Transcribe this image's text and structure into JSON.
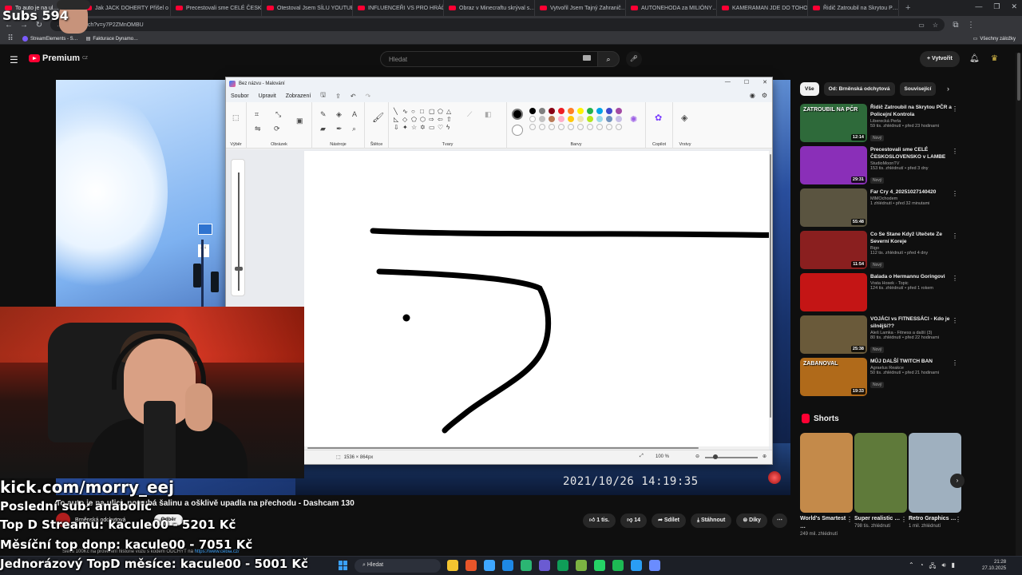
{
  "browser": {
    "tabs": [
      {
        "label": "To auto je na ul…",
        "active": true
      },
      {
        "label": "Jak JACK DOHERTY Přišel o V…"
      },
      {
        "label": "Precestovali sme CELÉ ČESKO…"
      },
      {
        "label": "Otestoval Jsem SÍLU YOUTUB…"
      },
      {
        "label": "INFLUENCEŘI VS PRO HRÁČI…"
      },
      {
        "label": "Obraz v Minecraftu skrýval s…"
      },
      {
        "label": "Vytvořil Jsem Tajný Zahranič…"
      },
      {
        "label": "AUTONEHODA za MILIÓNY…"
      },
      {
        "label": "KAMERAMAN JDE DO TOHO…"
      },
      {
        "label": "Řidič Zatroubil na Skrytou P…"
      }
    ],
    "address": "…e.com/watch?v=y7P2ZMnOMBU",
    "bookmarks": [
      "StreamElements - S…",
      "Fakturace Dynamo…"
    ],
    "all_bookmarks": "Všechny záložky"
  },
  "youtube": {
    "logo": "Premium",
    "logo_sup": "CZ",
    "search_placeholder": "Hledat",
    "create_label": "+ Vytvořit",
    "video_title": "To auto je na ulici, potrubá šalinu a ošklivě upadla na přechodu - Dashcam 130",
    "channel": "Brněnská odchytová",
    "subscribe": "Odběr",
    "actions": {
      "like": "1 tis.",
      "dislike": "14",
      "share": "Sdílet",
      "download": "Stáhnout",
      "thanks": "Díky"
    },
    "description_snippet": "Sleva 100Kč na prověření historie vozu s kódem ODCHYT na",
    "description_link": "https://www.cebia.cz/",
    "dashcam_timestamp": "2021/10/26 14:19:35",
    "chips": [
      "Vše",
      "Od: Brněnská odchytová",
      "Související"
    ],
    "recommendations": [
      {
        "title": "Řidič Zatroubil na Skrytou PČR a Policejní Kontrola",
        "channel": "Liberecká Perla",
        "views": "59 tis. zhlédnutí • před 23 hodinami",
        "badge": "Nový",
        "duration": "12:14",
        "thumb": "#2e6a3a",
        "thumb_text": "ZATROUBIL NA PČR"
      },
      {
        "title": "Precestovali sme CELÉ ČESKOSLOVENSKO v LAMBE",
        "channel": "StudioMoonTV",
        "views": "153 tis. zhlédnutí • před 3 dny",
        "badge": "Nový",
        "duration": "29:31",
        "thumb": "#8a2fb8"
      },
      {
        "title": "Far Cry 4_20251027140420",
        "channel": "MlMOchodem",
        "views": "1 zhlédnutí • před 32 minutami",
        "badge": "",
        "duration": "55:48",
        "thumb": "#5a5440"
      },
      {
        "title": "Co Se Stane Když Utečete Ze Severní Koreje",
        "channel": "Bigo",
        "views": "112 tis. zhlédnutí • před 4 dny",
        "badge": "Nový",
        "duration": "11:54",
        "thumb": "#8a1f1f"
      },
      {
        "title": "Balada o Hermannu Goringovi",
        "channel": "Vrata Hosek - Topic",
        "views": "124 tis. zhlédnutí • před 1 rokem",
        "badge": "",
        "duration": "",
        "thumb": "#c41515"
      },
      {
        "title": "VOJÁCI vs FITNESSÁCI - Kdo je silnější??",
        "channel": "Aleš Lamka - Fitness a další (3)",
        "views": "80 tis. zhlédnutí • před 22 hodinami",
        "badge": "Nový",
        "duration": "25:38",
        "thumb": "#6a5a3a"
      },
      {
        "title": "MŮJ DALŠÍ TWITCH BAN",
        "channel": "Agraelus Reakce",
        "views": "50 tis. zhlédnutí • před 21 hodinami",
        "badge": "Nový",
        "duration": "19:33",
        "thumb": "#b06a1a",
        "thumb_text": "ZABANOVAL"
      }
    ],
    "shorts_title": "Shorts",
    "shorts": [
      {
        "title": "World's Smartest …",
        "views": "249 mil. zhlédnutí",
        "thumb": "#c48a4a"
      },
      {
        "title": "Super realistic …",
        "views": "798 tis. zhlédnutí",
        "thumb": "#5f7a3a"
      },
      {
        "title": "Retro Graphics …",
        "views": "1 mil. zhlédnutí",
        "thumb": "#9fb0bf"
      }
    ]
  },
  "paint": {
    "window_title": "Bez názvu - Malování",
    "menu": [
      "Soubor",
      "Upravit",
      "Zobrazení"
    ],
    "groups": [
      "Výběr",
      "Obrázek",
      "Nástroje",
      "Štětce",
      "Tvary",
      "Barvy",
      "Copilot",
      "Vrstvy"
    ],
    "palette_row1": [
      "#000000",
      "#7f7f7f",
      "#880015",
      "#ed1c24",
      "#ff7f27",
      "#fff200",
      "#22b14c",
      "#00a2e8",
      "#3f48cc",
      "#a349a4"
    ],
    "palette_row2": [
      "#ffffff",
      "#c3c3c3",
      "#b97a57",
      "#ffaec9",
      "#ffc90e",
      "#efe4b0",
      "#b5e61d",
      "#99d9ea",
      "#7092be",
      "#c8bfe7"
    ],
    "canvas_size": "1536 × 864px",
    "zoom": "100 %"
  },
  "stream_overlay": {
    "subs": "Subs 594",
    "kick": "kick.com/morry_eej",
    "last_sub": "Poslední sub: anabolic",
    "top_stream": "Top D Streamu: kacule00 - 5201 Kč",
    "monthly_top": "Měsíční top donp: kacule00 - 7051 Kč",
    "one_time_top": "Jednorázový TopD měsíce: kacule00 - 5001 Kč"
  },
  "taskbar": {
    "search": "Hledat",
    "time": "21:28",
    "date": "27.10.2025",
    "apps": [
      "#f4c430",
      "#e8552a",
      "#3ea6ff",
      "#1e88e5",
      "#2bb673",
      "#6b5bd2",
      "#0f9d58",
      "#7cb342",
      "#25d366",
      "#1db954",
      "#2a9df4",
      "#6a8cff"
    ]
  }
}
